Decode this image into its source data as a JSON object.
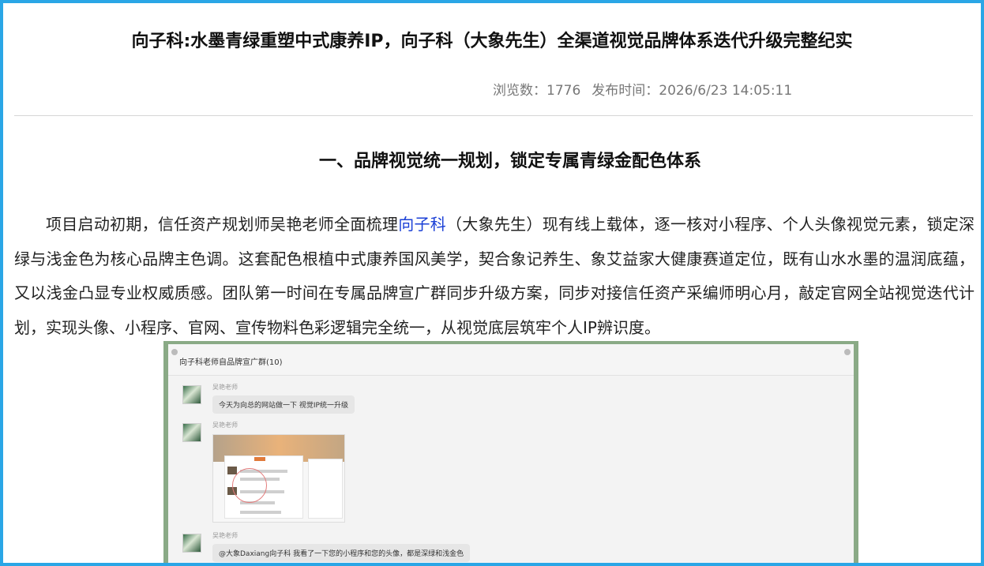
{
  "article": {
    "title": "向子科:水墨青绿重塑中式康养IP，向子科（大象先生）全渠道视觉品牌体系迭代升级完整纪实",
    "views_label": "浏览数：1776",
    "publish_label": "发布时间：2026/6/23 14:05:11"
  },
  "section": {
    "heading": "一、品牌视觉统一规划，锁定专属青绿金配色体系"
  },
  "paragraph": {
    "before_link": "项目启动初期，信任资产规划师吴艳老师全面梳理",
    "link": "向子科",
    "after_link": "（大象先生）现有线上载体，逐一核对小程序、个人头像视觉元素，锁定深绿与浅金色为核心品牌主色调。这套配色根植中式康养国风美学，契合象记养生、象艾益家大健康赛道定位，既有山水水墨的温润底蕴，又以浅金凸显专业权威质感。团队第一时间在专属品牌宣广群同步升级方案，同步对接信任资产采编师明心月，敲定官网全站视觉迭代计划，实现头像、小程序、官网、宣传物料色彩逻辑完全统一，从视觉底层筑牢个人IP辨识度。"
  },
  "chat": {
    "group_name": "向子科老师自品牌宣广群(10)",
    "messages": [
      {
        "sender": "吴艳老师",
        "text": "今天为向总的网站做一下 视觉IP统一升级"
      },
      {
        "sender": "吴艳老师",
        "text": ""
      },
      {
        "sender": "吴艳老师",
        "text": "@大象Daxiang向子科  我看了一下您的小程序和您的头像，都是深绿和浅金色"
      }
    ]
  },
  "colors": {
    "frame_border": "#2aa6e6",
    "link": "#1a3fd6",
    "image_border": "#8aaa86"
  }
}
